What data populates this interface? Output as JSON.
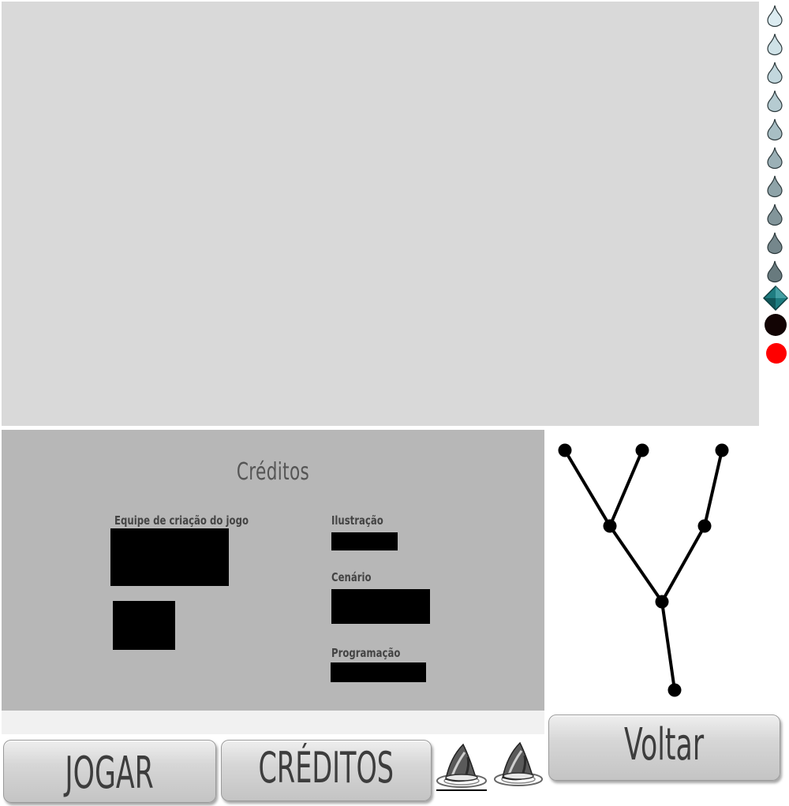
{
  "credits": {
    "title": "Créditos",
    "team_label": "Equipe de criação do jogo",
    "illustration_label": "Ilustração",
    "scenery_label": "Cenário",
    "programming_label": "Programação"
  },
  "buttons": {
    "play": "JOGAR",
    "credits": "CRÉDITOS",
    "back": "Voltar"
  },
  "sprites": {
    "drops_count": 10,
    "drop_colors": [
      "#dcecf1",
      "#cfe2e7",
      "#c2d7dd",
      "#b5cbd1",
      "#a8bec4",
      "#9bb0b6",
      "#8ea3a8",
      "#82959a",
      "#75878c",
      "#687a7e"
    ],
    "gem_color": "#1e7c80",
    "black_ball_color": "#120404",
    "red_ball_color": "#ff0000"
  },
  "icons": [
    "water-drop-icon",
    "diamond-gem-icon",
    "black-ball-icon",
    "red-ball-icon",
    "wizard-hat-icon",
    "branch-tree-icon"
  ]
}
